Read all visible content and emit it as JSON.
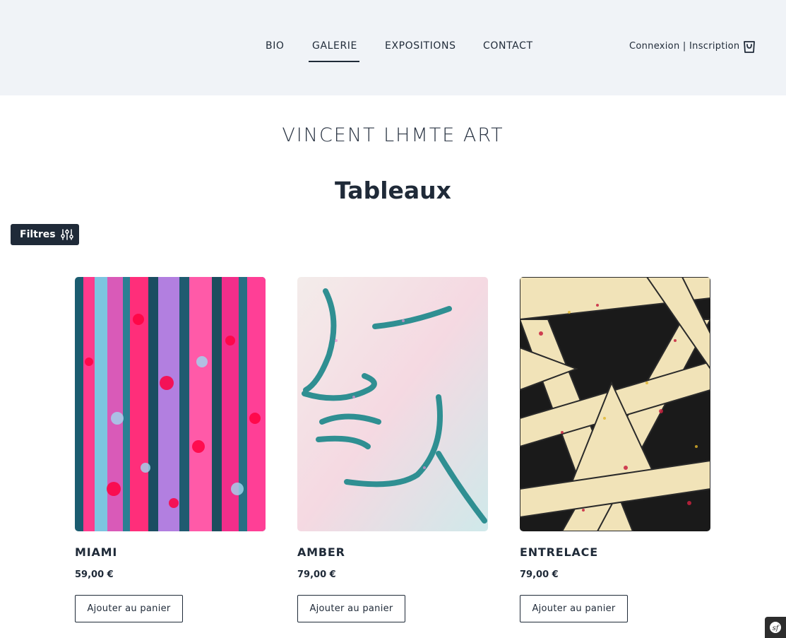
{
  "nav": {
    "items": [
      {
        "label": "BIO"
      },
      {
        "label": "GALERIE",
        "active": true
      },
      {
        "label": "EXPOSITIONS"
      },
      {
        "label": "CONTACT"
      }
    ]
  },
  "auth": {
    "login": "Connexion",
    "separator": "|",
    "signup": "Inscription",
    "cart_icon": "shopping-bag-icon"
  },
  "brand": "VINCENT LHMTE ART",
  "page_title": "Tableaux",
  "filters": {
    "label": "Filtres",
    "icon": "sliders-icon"
  },
  "products": [
    {
      "name": "MIAMI",
      "price": "59,00 €",
      "button": "Ajouter au panier"
    },
    {
      "name": "AMBER",
      "price": "79,00 €",
      "button": "Ajouter au panier"
    },
    {
      "name": "ENTRELACE",
      "price": "79,00 €",
      "button": "Ajouter au panier"
    }
  ],
  "colors": {
    "header_bg": "#f0f3f7",
    "dark": "#1f2a38",
    "accent_pink": "#ff2e86",
    "accent_teal": "#2d8a99"
  },
  "debug_toolbar_icon": "symfony-icon"
}
